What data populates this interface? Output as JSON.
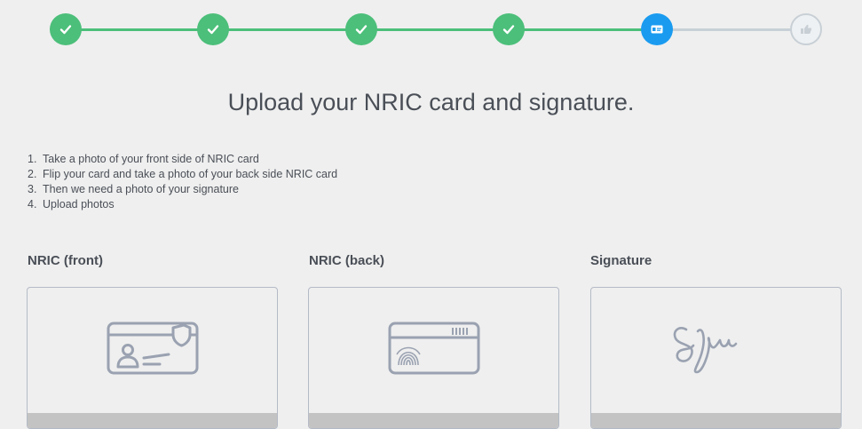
{
  "stepper": {
    "steps": [
      {
        "state": "done",
        "icon": "check-icon"
      },
      {
        "state": "done",
        "icon": "check-icon"
      },
      {
        "state": "done",
        "icon": "check-icon"
      },
      {
        "state": "done",
        "icon": "check-icon"
      },
      {
        "state": "active",
        "icon": "id-card-icon"
      },
      {
        "state": "pending",
        "icon": "thumbs-up-icon"
      }
    ],
    "colors": {
      "done": "#4cbf7a",
      "active": "#1a9bf0",
      "pending": "#c8d0d6"
    }
  },
  "page": {
    "title": "Upload your NRIC card and signature."
  },
  "instructions": [
    {
      "num": "1.",
      "text": "Take a photo of your front side of NRIC card"
    },
    {
      "num": "2.",
      "text": "Flip your card and take a photo of your back side NRIC card"
    },
    {
      "num": "3.",
      "text": "Then we need a photo of your signature"
    },
    {
      "num": "4.",
      "text": "Upload photos"
    }
  ],
  "uploads": [
    {
      "label": "NRIC (front)",
      "icon": "id-card-front-icon"
    },
    {
      "label": "NRIC (back)",
      "icon": "id-card-back-fingerprint-icon"
    },
    {
      "label": "Signature",
      "icon": "signature-icon"
    }
  ]
}
